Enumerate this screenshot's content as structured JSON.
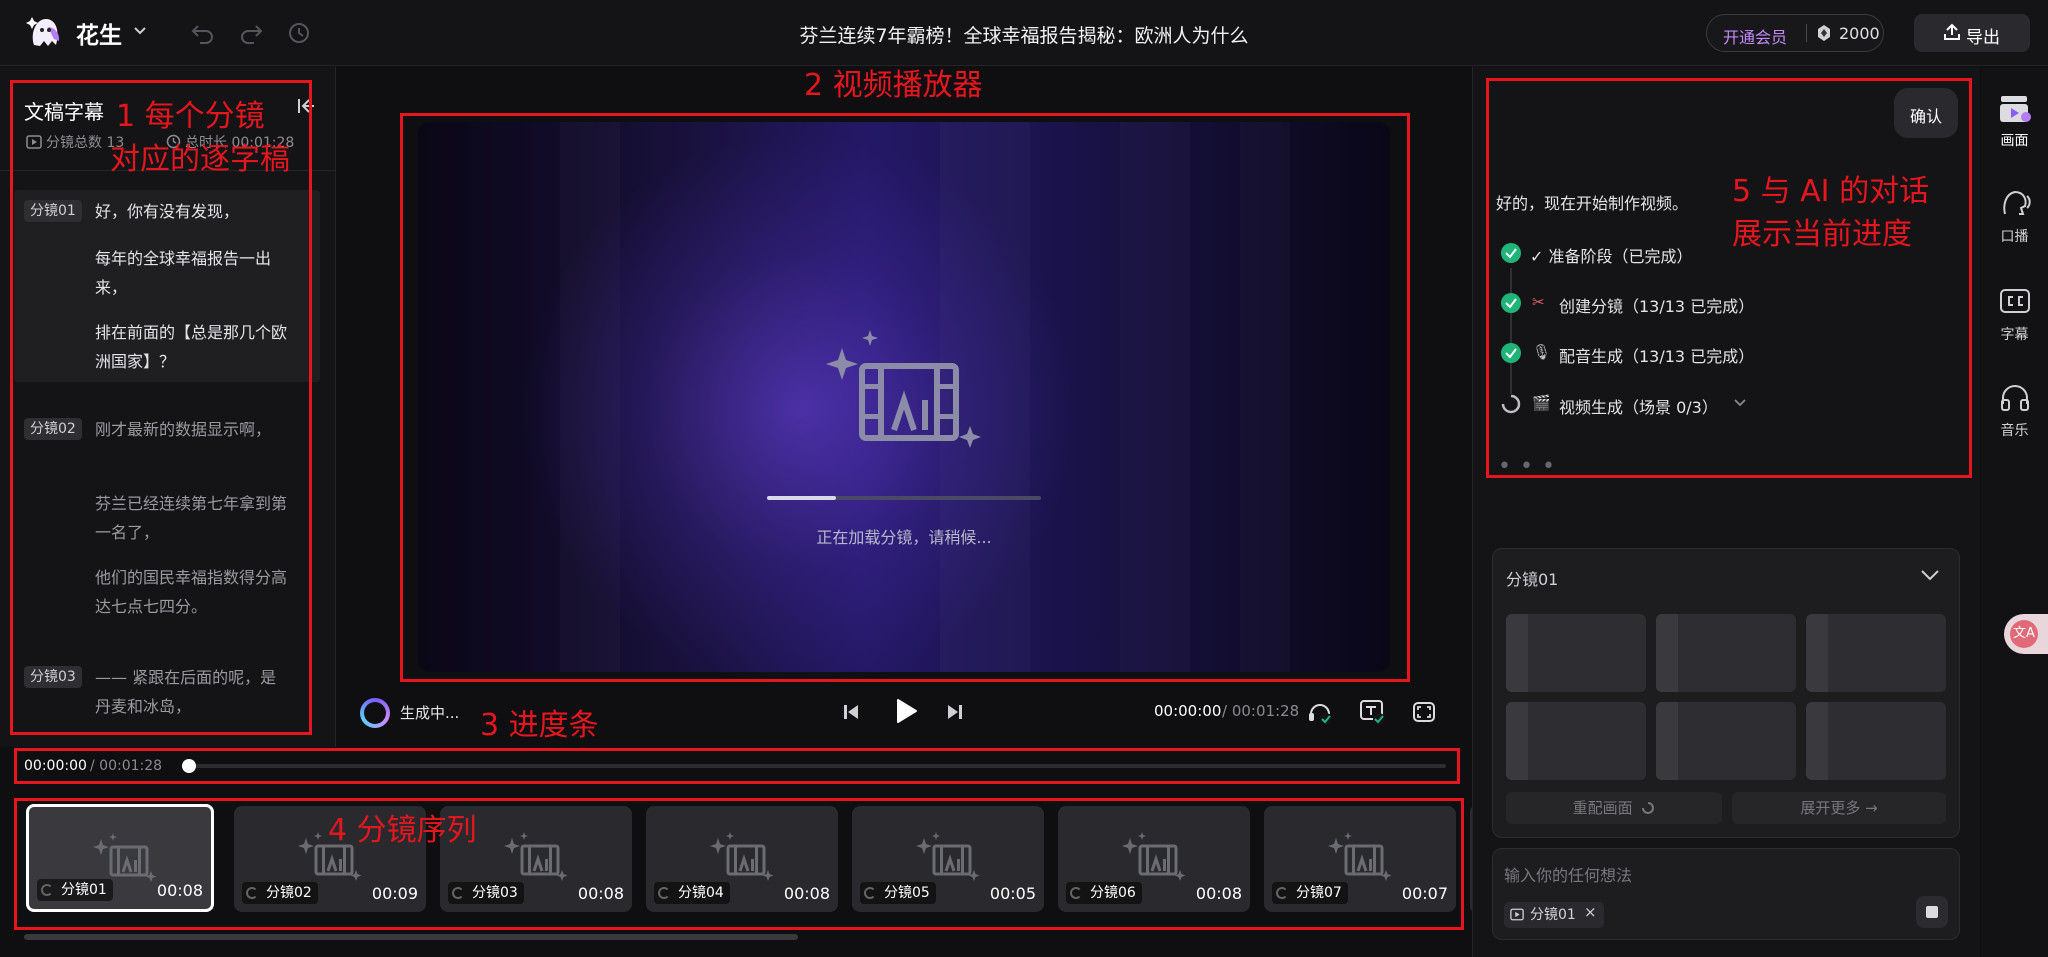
{
  "app": {
    "brand": "花生",
    "doc_title": "芬兰连续7年霸榜！全球幸福报告揭秘：欧洲人为什么",
    "member_label": "开通会员",
    "credits": "2000",
    "export_label": "导出"
  },
  "script_panel": {
    "title": "文稿字幕",
    "scene_count": "分镜总数 13",
    "total_duration": "总时长 00:01:28",
    "scenes": [
      {
        "tag": "分镜01",
        "lines": [
          "好，你有没有发现，",
          "每年的全球幸福报告一出来，",
          "排在前面的【总是那几个欧洲国家】？"
        ]
      },
      {
        "tag": "分镜02",
        "lines": [
          "刚才最新的数据显示啊，",
          "芬兰已经连续第七年拿到第一名了，",
          "他们的国民幸福指数得分高达七点七四分。"
        ]
      },
      {
        "tag": "分镜03",
        "lines": [
          "—— 紧跟在后面的呢，是丹麦和冰岛，"
        ]
      }
    ]
  },
  "player": {
    "loading_text": "正在加载分镜，请稍候...",
    "loading_progress": 0.25,
    "generating_label": "生成中...",
    "time_current": "00:00:00",
    "time_total": "/ 00:01:28"
  },
  "timeline": {
    "time_current": "00:00:00",
    "time_total": "/ 00:01:28",
    "position": 0
  },
  "scene_strip": [
    {
      "label": "分镜01",
      "duration": "00:08",
      "selected": true
    },
    {
      "label": "分镜02",
      "duration": "00:09"
    },
    {
      "label": "分镜03",
      "duration": "00:08"
    },
    {
      "label": "分镜04",
      "duration": "00:08"
    },
    {
      "label": "分镜05",
      "duration": "00:05"
    },
    {
      "label": "分镜06",
      "duration": "00:08"
    },
    {
      "label": "分镜07",
      "duration": "00:07"
    }
  ],
  "chat": {
    "confirm": "确认",
    "message": "好的，现在开始制作视频。",
    "steps": [
      {
        "icon": "check",
        "emoji": "",
        "text": "✓ 准备阶段（已完成）"
      },
      {
        "icon": "check",
        "emoji": "✂",
        "text": "创建分镜（13/13 已完成）"
      },
      {
        "icon": "check",
        "emoji": "🎙",
        "text": "配音生成（13/13 已完成）"
      },
      {
        "icon": "spinner",
        "emoji": "🎬",
        "text": "视频生成（场景 0/3）"
      }
    ],
    "dots": "• • •"
  },
  "scene_panel": {
    "title": "分镜01",
    "rematch_label": "重配画面",
    "expand_label": "展开更多 →"
  },
  "input": {
    "placeholder": "输入你的任何想法",
    "chip": "分镜01"
  },
  "rail": [
    {
      "icon": "picture-icon",
      "label": "画面",
      "active": true
    },
    {
      "icon": "voice-icon",
      "label": "口播"
    },
    {
      "icon": "cc-icon",
      "label": "字幕"
    },
    {
      "icon": "headphones-icon",
      "label": "音乐"
    }
  ],
  "annotations": {
    "a1_line1": "1 每个分镜",
    "a1_line2": "对应的逐字稿",
    "a2": "2 视频播放器",
    "a3": "3 进度条",
    "a4": "4 分镜序列",
    "a5_line1": "5 与 AI 的对话",
    "a5_line2": "展示当前进度"
  },
  "colors": {
    "annotation_red": "#e5161e",
    "member_purple": "#c58af9",
    "success_green": "#1fb478"
  }
}
